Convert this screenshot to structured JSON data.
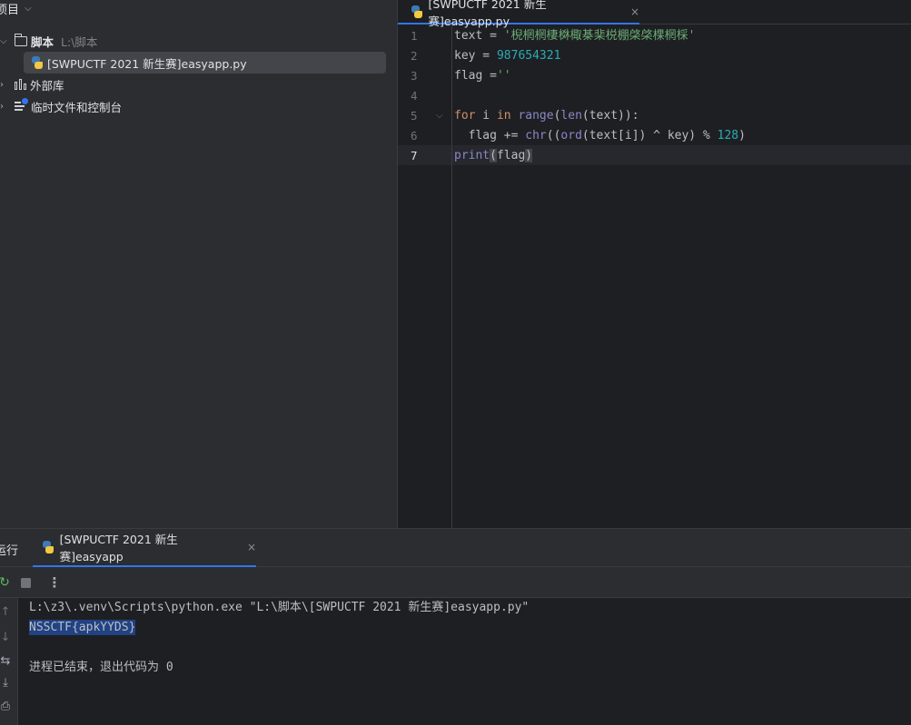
{
  "project": {
    "title": "项目",
    "tree": {
      "root": {
        "label": "脚本",
        "hint": "L:\\脚本"
      },
      "file": {
        "label": "[SWPUCTF 2021 新生赛]easyapp.py"
      },
      "external_libs": {
        "label": "外部库"
      },
      "scratches": {
        "label": "临时文件和控制台"
      }
    }
  },
  "editor": {
    "tab": {
      "label": "[SWPUCTF 2021 新生赛]easyapp.py",
      "close": "×"
    },
    "line_numbers": [
      "1",
      "2",
      "3",
      "4",
      "5",
      "6",
      "7"
    ],
    "current_line": 7,
    "code": {
      "l1": {
        "kw": "text",
        "op": " = ",
        "str": "'棿棢棢棲棥棷棊棐棁棚棨棨棵棢棌'"
      },
      "l2": {
        "kw": "key",
        "op": " = ",
        "num": "987654321"
      },
      "l3": {
        "kw": "flag",
        "op": " =",
        "str": "''"
      },
      "l5": {
        "for": "for",
        "i": " i ",
        "in": "in",
        "sp": " ",
        "range": "range",
        "p1": "(",
        "len": "len",
        "rest": "(text)):"
      },
      "l6": {
        "indent": "  flag += ",
        "chr": "chr",
        "p1": "((",
        "ord": "ord",
        "mid": "(text[i]) ^ key) % ",
        "num": "128",
        "end": ")"
      },
      "l7": {
        "print": "print",
        "open": "(",
        "arg": "flag",
        "close": ")"
      }
    }
  },
  "run": {
    "title": "运行",
    "tab": {
      "label": "[SWPUCTF 2021 新生赛]easyapp",
      "close": "×"
    },
    "toolbar": {
      "rerun": "↻",
      "more": "⋮"
    },
    "side": {
      "up": "↑",
      "down": "↓",
      "wrap": "⇆",
      "scroll_end": "⤓",
      "print": "⎙"
    },
    "console": {
      "command": "L:\\z3\\.venv\\Scripts\\python.exe \"L:\\脚本\\[SWPUCTF 2021 新生赛]easyapp.py\"",
      "output": "NSSCTF{apkYYDS}",
      "exit": "进程已结束，退出代码为 0"
    }
  },
  "colors": {
    "keyword": "#cf8e6d",
    "string": "#6aab73",
    "number": "#2aacb8",
    "function": "#56a8f5",
    "builtin": "#8888c6",
    "accent": "#3574f0",
    "selection": "#214283"
  }
}
